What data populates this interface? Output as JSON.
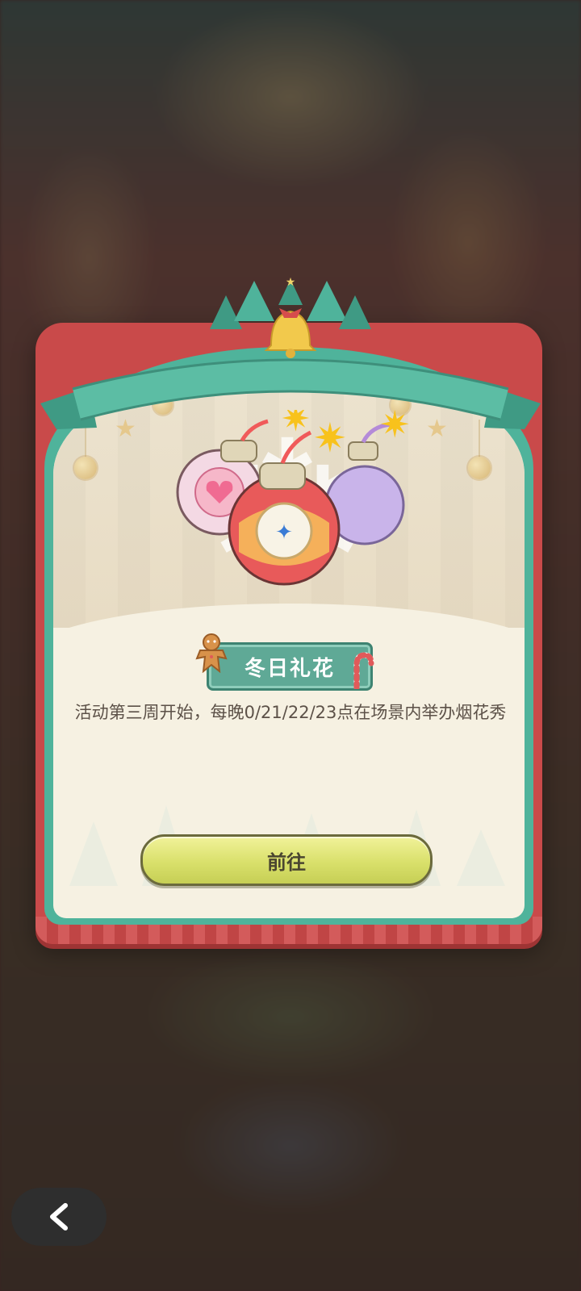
{
  "dialog": {
    "title": "冬日礼花",
    "description": "活动第三周开始，每晚0/21/22/23点在场景内举办烟花秀",
    "go_button_label": "前往"
  },
  "nav": {
    "back_icon": "chevron-left-icon"
  },
  "colors": {
    "card_red": "#c94a4a",
    "card_teal": "#4fb39b",
    "card_cream": "#f6f1e2",
    "button_yellow": "#d9e06b",
    "title_tag": "#5fa996"
  }
}
